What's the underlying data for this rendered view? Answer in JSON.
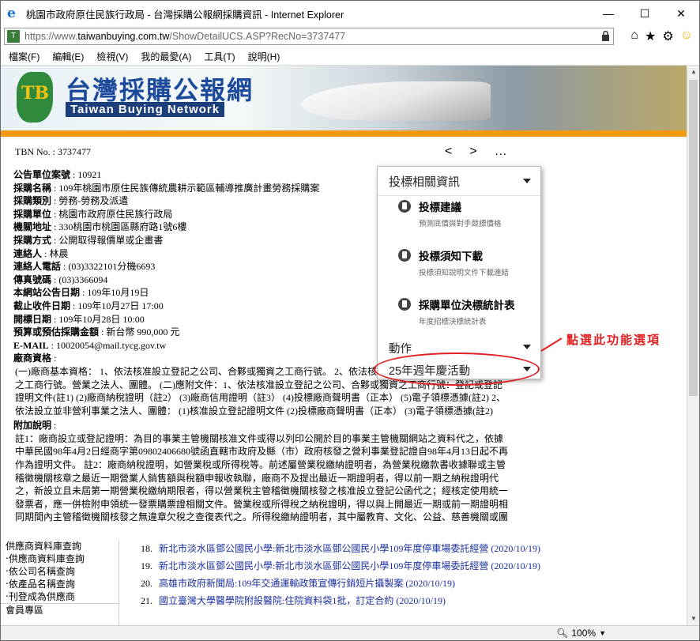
{
  "window": {
    "title": "桃園市政府原住民族行政局 - 台灣採購公報網採購資訊 - Internet Explorer",
    "url_prefix": "https://www.",
    "url_domain": "taiwanbuying.com.tw",
    "url_path": "/ShowDetailUCS.ASP?RecNo=3737477"
  },
  "menu": [
    "檔案(F)",
    "編輯(E)",
    "檢視(V)",
    "我的最愛(A)",
    "工具(T)",
    "說明(H)"
  ],
  "banner": {
    "cn": "台灣採購公報網",
    "en": "Taiwan Buying Network",
    "tb": "TB"
  },
  "tbn": "TBN No. : 3737477",
  "nav": {
    "prev": "<",
    "next": ">",
    "more": "…"
  },
  "details": [
    {
      "k": "公告單位案號",
      "v": "10921"
    },
    {
      "k": "採購名稱",
      "v": "109年桃園市原住民族傳統農耕示範區輔導推廣計畫勞務採購案"
    },
    {
      "k": "採購類別",
      "v": "勞務-勞務及派遣"
    },
    {
      "k": "採購單位",
      "v": "桃園市政府原住民族行政局"
    },
    {
      "k": "機關地址",
      "v": "330桃園市桃園區縣府路1號6樓"
    },
    {
      "k": "採購方式",
      "v": "公開取得報價單或企畫書"
    },
    {
      "k": "連絡人",
      "v": "林晨"
    },
    {
      "k": "連絡人電話",
      "v": "(03)3322101分機6693"
    },
    {
      "k": "傳真號碼",
      "v": "(03)3366094"
    },
    {
      "k": "本網站公告日期",
      "v": "109年10月19日"
    },
    {
      "k": "截止收件日期",
      "v": "109年10月27日 17:00"
    },
    {
      "k": "開標日期",
      "v": "109年10月28日 10:00"
    },
    {
      "k": "預算或預估採購金額",
      "v": "新台幣 990,000 元"
    },
    {
      "k": "E-MAIL",
      "v": "10020054@mail.tycg.gov.tw"
    },
    {
      "k": "廠商資格",
      "v": ""
    }
  ],
  "qualification_text": "(一)廠商基本資格： 1、依法核准設立登記之公司、合夥或獨資之工商行號。 2、依法核准設立登記之公司、合夥或獨資之工商行號。營業之法人、團體。 (二)應附文件：1、依法核准設立登記之公司、合夥或獨資之工商行號：登記或登記證明文件(註1) (2)廠商納稅證明（註2） (3)廠商信用證明（註3） (4)投標廠商聲明書（正本） (5)電子領標憑據(註2) 2、依法設立並非營利事業之法人、團體： (1)核准設立登記證明文件 (2)投標廠商聲明書（正本） (3)電子領標憑據(註2)",
  "remark_label": "附加說明",
  "remark_text": "註1：廠商設立或登記證明：為目的事業主管機關核准文件或得以列印公開於目的事業主管機關網站之資料代之，依據中華民國98年4月2日經商字第09802406680號函直轄市政府及縣（市）政府核發之營利事業登記證自98年4月13日起不再作為證明文件。 註2：廠商納稅證明，如營業稅或所得稅等。前述屬營業稅繳納證明者，為營業稅繳款書收據聯或主管稽徵機關核章之最近一期營業人銷售額與稅額申報收執聯，廠商不及提出最近一期證明者，得以前一期之納稅證明代之，新設立且未屆第一期營業稅繳納期限者，得以營業稅主管稽徵機關核發之核准設立登記公函代之；經核定使用統一發票者，應一併檢附申領統一發票購票證相關文件。營業稅或所得稅之納稅證明，得以與上開最近一期或前一期證明相同期間內主管稽徵機關核發之無違章欠稅之查復表代之。所得稅繳納證明者，其中屬教育、文化、公益、慈善機關或團",
  "dropdown": {
    "head": "投標相關資訊",
    "items": [
      {
        "title": "投標建議",
        "sub": "預測底價與對手競標價格"
      },
      {
        "title": "投標須知下載",
        "sub": "投標須知說明文件下載連結"
      },
      {
        "title": "採購單位決標統計表",
        "sub": "年度招標決標統計表"
      }
    ],
    "sec1": "動作",
    "sec2": "25年週年慶活動"
  },
  "callout": "點選此功能選項",
  "leftnav": [
    "供應商資料庫查詢",
    "‧供應商資料庫查詢",
    "‧依公司名稱查詢",
    "‧依產品名稱查詢",
    "‧刊登成為供應商",
    "會員專區"
  ],
  "list": [
    {
      "n": "18.",
      "t": "新北市淡水區鄧公國民小學:新北市淡水區鄧公國民小學109年度停車場委託經營 (2020/10/19)"
    },
    {
      "n": "19.",
      "t": "新北市淡水區鄧公國民小學:新北市淡水區鄧公國民小學109年度停車場委託經營 (2020/10/19)"
    },
    {
      "n": "20.",
      "t": "高雄市政府新聞局:109年交通運輸政策宣傳行銷短片攝製案 (2020/10/19)"
    },
    {
      "n": "21.",
      "t": "國立臺灣大學醫學院附設醫院:住院資料袋1批，訂定合約 (2020/10/19)"
    }
  ],
  "status": {
    "zoom": "100%"
  }
}
